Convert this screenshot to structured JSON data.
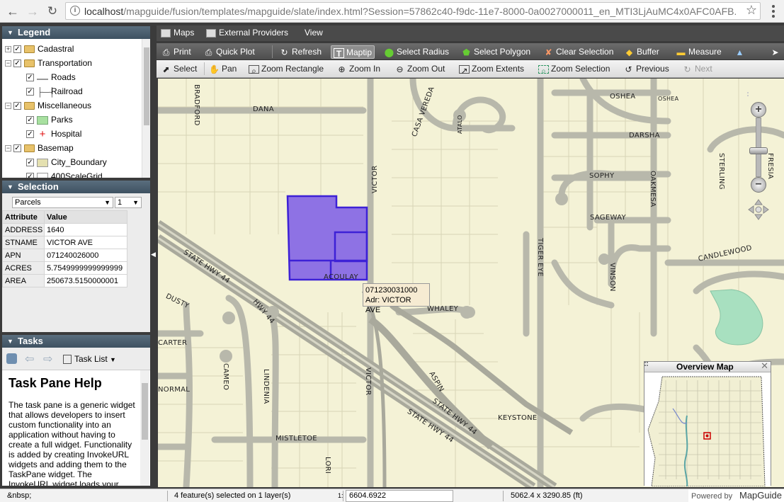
{
  "browser": {
    "url_host": "localhost",
    "url_path": "/mapguide/fusion/templates/mapguide/slate/index.html?Session=57862c40-f9dc-11e7-8000-0a0027000011_en_MTI3LjAuMC4x0AFC0AFB..."
  },
  "legend": {
    "title": "Legend",
    "items": [
      {
        "label": "Cadastral"
      },
      {
        "label": "Transportation"
      },
      {
        "label": "Roads"
      },
      {
        "label": "Railroad"
      },
      {
        "label": "Miscellaneous"
      },
      {
        "label": "Parks"
      },
      {
        "label": "Hospital"
      },
      {
        "label": "Basemap"
      },
      {
        "label": "City_Boundary"
      },
      {
        "label": "400ScaleGrid"
      }
    ]
  },
  "selection": {
    "title": "Selection",
    "layer": "Parcels",
    "index": "1",
    "header_attr": "Attribute",
    "header_value": "Value",
    "rows": [
      {
        "k": "ADDRESS",
        "v": "1640"
      },
      {
        "k": "STNAME",
        "v": "VICTOR AVE"
      },
      {
        "k": "APN",
        "v": "071240026000"
      },
      {
        "k": "ACRES",
        "v": "5.7549999999999999"
      },
      {
        "k": "AREA",
        "v": "250673.5150000001"
      }
    ]
  },
  "tasks": {
    "title": "Tasks",
    "task_list_label": "Task List",
    "pane_title": "Task Pane Help",
    "pane_text": "The task pane is a generic widget that allows developers to insert custom functionality into an application without having to create a full widget. Functionality is added by creating InvokeURL widgets and adding them to the TaskPane widget. The InvokeURL widget loads your"
  },
  "menubar": {
    "maps": "Maps",
    "external_providers": "External Providers",
    "view": "View"
  },
  "toolbar1": {
    "print": "Print",
    "quick_plot": "Quick Plot",
    "refresh": "Refresh",
    "maptip": "Maptip",
    "select_radius": "Select Radius",
    "select_polygon": "Select Polygon",
    "clear_selection": "Clear Selection",
    "buffer": "Buffer",
    "measure": "Measure"
  },
  "toolbar2": {
    "select": "Select",
    "pan": "Pan",
    "zoom_rectangle": "Zoom Rectangle",
    "zoom_in": "Zoom In",
    "zoom_out": "Zoom Out",
    "zoom_extents": "Zoom Extents",
    "zoom_selection": "Zoom Selection",
    "previous": "Previous",
    "next": "Next"
  },
  "map": {
    "maptip_line1": "071230031000",
    "maptip_line2": "Adr: VICTOR AVE",
    "streets": {
      "bradford": "BRADFORD",
      "dana": "DANA",
      "casa_vereda": "CASA VEREDA",
      "atalo": "ATALO",
      "oshea1": "OSHEA",
      "oshea2": "OSHEA",
      "darsha": "DARSHA",
      "victor1": "VICTOR",
      "sophy": "SOPHY",
      "oakmesa": "OAKMESA",
      "sterling": "STERLING",
      "fresia": "FRESIA",
      "sageway": "SAGEWAY",
      "tiger_eye": "TIGER EYE",
      "vinson": "VINSON",
      "candlewood": "CANDLEWOOD",
      "state_hwy_44_a": "STATE HWY 44",
      "hwy_44": "HWY 44",
      "acoulay": "ACOULAY",
      "dusty": "DUSTY",
      "whaley": "WHALEY",
      "carter": "CARTER",
      "cameo": "CAMEO",
      "lindenia": "LINDENIA",
      "victor2": "VICTOR",
      "aspin": "ASPIN",
      "state_hwy_44_b": "STATE HWY 44",
      "state_hwy_44_c": "STATE HWY 44",
      "normal": "NORMAL",
      "keystone": "KEYSTONE",
      "mistletoe": "MISTLETOE",
      "lori": "LORI"
    },
    "overview_title": "Overview Map"
  },
  "status": {
    "left": "&nbsp;",
    "selected": "4 feature(s) selected on 1 layer(s)",
    "scale_prefix": "1:",
    "scale": "6604.6922",
    "size": "5062.4 x 3290.85 (ft)",
    "powered_by": "Powered by",
    "brand": "MapGuide"
  },
  "colors": {
    "panel_header": "#4b5e6e",
    "map_bg": "#f4f2d6",
    "selection_fill": "#7b5ce6",
    "road": "#bbbbb0"
  }
}
